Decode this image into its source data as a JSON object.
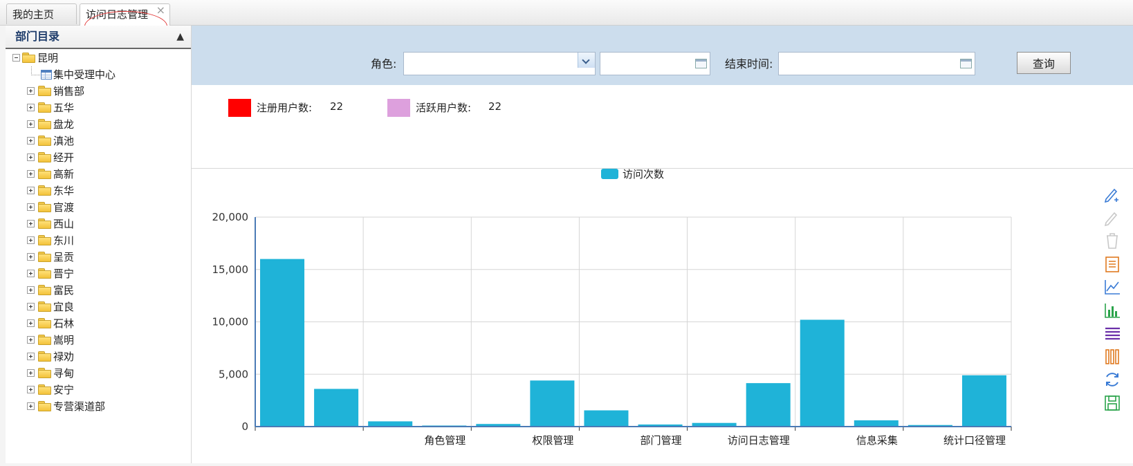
{
  "tabs": [
    {
      "label": "我的主页",
      "active": false
    },
    {
      "label": "访问日志管理",
      "active": true,
      "close": "×"
    }
  ],
  "sidebar": {
    "title": "部门目录",
    "root": "昆明",
    "children": [
      "集中受理中心",
      "销售部",
      "五华",
      "盘龙",
      "滇池",
      "经开",
      "高新",
      "东华",
      "官渡",
      "西山",
      "东川",
      "呈贡",
      "晋宁",
      "富民",
      "宜良",
      "石林",
      "嵩明",
      "禄劝",
      "寻甸",
      "安宁",
      "专营渠道部"
    ]
  },
  "filter": {
    "role_label": "角色:",
    "role_value": "",
    "start_value": "",
    "end_label": "结束时间:",
    "end_value": "",
    "query_label": "查询"
  },
  "stats": {
    "registered_label": "注册用户数:",
    "registered_value": "22",
    "registered_color": "#ff0000",
    "active_label": "活跃用户数:",
    "active_value": "22",
    "active_color": "#dda0dd"
  },
  "chart_data": {
    "type": "bar",
    "series": [
      {
        "name": "访问次数",
        "color": "#1fb3d8",
        "values": [
          16000,
          3600,
          500,
          100,
          250,
          4400,
          1550,
          200,
          350,
          4150,
          10200,
          600,
          150,
          4900
        ]
      }
    ],
    "x_tick_labels": [
      "",
      "角色管理",
      "权限管理",
      "部门管理",
      "访问日志管理",
      "信息采集",
      "统计口径管理"
    ],
    "y_ticks": [
      "0",
      "5,000",
      "10,000",
      "15,000",
      "20,000"
    ],
    "ylim": [
      0,
      20000
    ],
    "legend_position": "top-center",
    "grid": true
  },
  "toolbar_icons": [
    "add-edit-icon",
    "edit-icon",
    "delete-icon",
    "report-icon",
    "line-chart-icon",
    "bar-chart-icon",
    "rows-icon",
    "columns-icon",
    "refresh-icon",
    "save-icon"
  ]
}
